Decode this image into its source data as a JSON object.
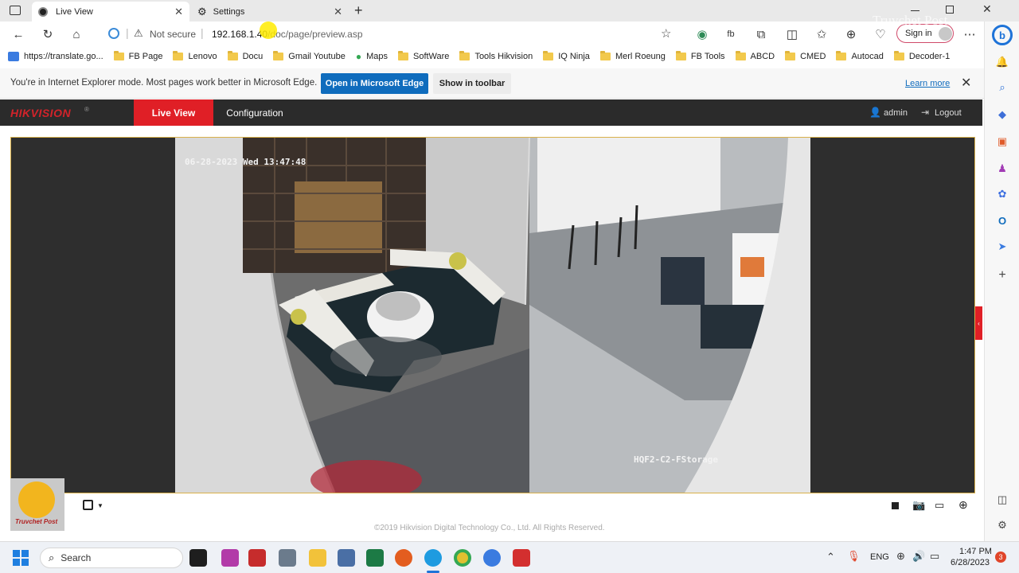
{
  "browser": {
    "tabs": [
      {
        "label": "Live View"
      },
      {
        "label": "Settings"
      }
    ],
    "new_tab": "+",
    "security_label": "Not secure",
    "url_host": "192.168.1.40",
    "url_path": "/doc/page/preview.asp",
    "signin_label": "Sign in",
    "bookmarks": [
      {
        "label": "https://translate.go...",
        "icon": "translate-icon"
      },
      {
        "label": "FB Page",
        "icon": "folder-icon"
      },
      {
        "label": "Lenovo",
        "icon": "folder-icon"
      },
      {
        "label": "Docu",
        "icon": "folder-icon"
      },
      {
        "label": "Gmail Youtube",
        "icon": "folder-icon"
      },
      {
        "label": "Maps",
        "icon": "maps-icon"
      },
      {
        "label": "SoftWare",
        "icon": "folder-icon"
      },
      {
        "label": "Tools Hikvision",
        "icon": "folder-icon"
      },
      {
        "label": "IQ Ninja",
        "icon": "folder-icon"
      },
      {
        "label": "Merl Roeung",
        "icon": "folder-icon"
      },
      {
        "label": "FB Tools",
        "icon": "folder-icon"
      },
      {
        "label": "ABCD",
        "icon": "folder-icon"
      },
      {
        "label": "CMED",
        "icon": "folder-icon"
      },
      {
        "label": "Autocad",
        "icon": "folder-icon"
      },
      {
        "label": "Decoder-1",
        "icon": "folder-icon"
      }
    ],
    "ie_notice": "You're in Internet Explorer mode. Most pages work better in Microsoft Edge.",
    "ie_open_button": "Open in Microsoft Edge",
    "ie_toolbar_button": "Show in toolbar",
    "ie_learn_more": "Learn more"
  },
  "hikvision": {
    "logo": "HIKVISION",
    "nav": [
      {
        "label": "Live View",
        "active": true
      },
      {
        "label": "Configuration",
        "active": false
      }
    ],
    "user": "admin",
    "logout": "Logout",
    "osd_timestamp": "06-28-2023 Wed 13:47:48",
    "osd_camera_name": "HQF2-C2-FStorage",
    "footer": "©2019 Hikvision Digital Technology Co., Ltd. All Rights Reserved."
  },
  "watermark": {
    "badge_text": "Truvchet Post",
    "corner_text": "Truvchet Post"
  },
  "taskbar": {
    "search_placeholder": "Search",
    "language": "ENG",
    "time": "1:47 PM",
    "date": "6/28/2023",
    "notification_count": "3"
  },
  "colors": {
    "hik_red": "#e01f26",
    "hik_bar": "#2b2b2b",
    "edge_blue": "#0f6cbd",
    "video_border": "#d9b04a"
  }
}
